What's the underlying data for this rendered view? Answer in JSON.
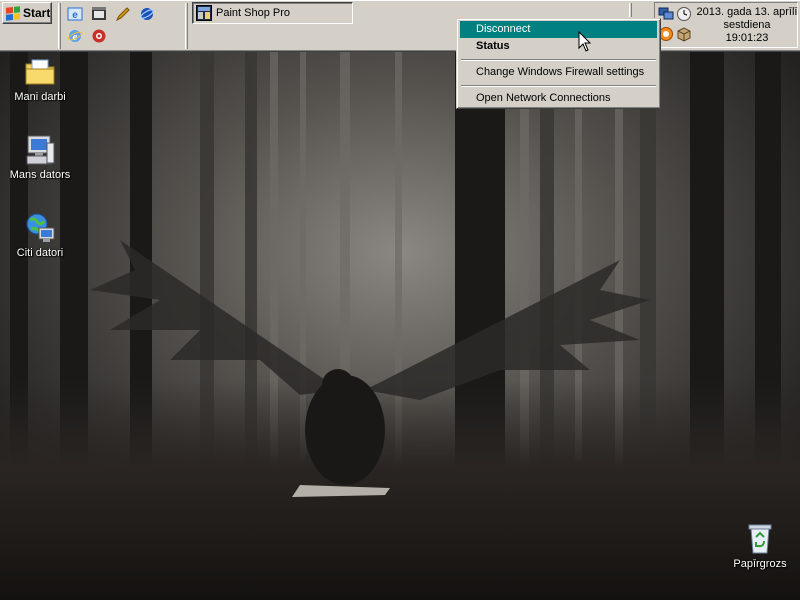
{
  "taskbar": {
    "start_label": "Start",
    "quick_launch": [
      {
        "icon": "ie-browser-icon",
        "color": "#2a6fd6"
      },
      {
        "icon": "media-clip-icon",
        "color": "#3a3a3a"
      },
      {
        "icon": "pencil-tool-icon",
        "color": "#d89a12"
      },
      {
        "icon": "orbit-app-icon",
        "color": "#1d4fb8"
      },
      {
        "icon": "ie-e-icon",
        "color": "#1f63c4"
      },
      {
        "icon": "red-round-app-icon",
        "color": "#c8302a"
      }
    ],
    "task_buttons": [
      {
        "label": "Paint Shop Pro",
        "icon": "paint-shop-pro-icon"
      }
    ]
  },
  "tray": {
    "date_line1": "2013. gada 13. aprīlī",
    "date_line2": "sestdiena",
    "time": "19:01:23",
    "icons": [
      "network-monitor-icon",
      "clock-tray-icon",
      "orange-tray-icon",
      "box-tray-icon"
    ]
  },
  "context_menu": {
    "items": [
      {
        "label": "Disconnect",
        "highlighted": true
      },
      {
        "label": "Status",
        "bold": true
      },
      {
        "label": "Change Windows Firewall settings"
      },
      {
        "label": "Open Network Connections"
      }
    ]
  },
  "desktop_icons": [
    {
      "label": "Mani darbi",
      "icon": "my-documents-folder-icon"
    },
    {
      "label": "Mans dators",
      "icon": "my-computer-icon"
    },
    {
      "label": "Citi datori",
      "icon": "network-places-icon"
    },
    {
      "label": "Papīrgrozs",
      "icon": "recycle-bin-icon"
    }
  ],
  "colors": {
    "taskbar_bg": "#d4d0c8",
    "menu_highlight": "#008080",
    "wallpaper_fog": "#7a7670"
  }
}
